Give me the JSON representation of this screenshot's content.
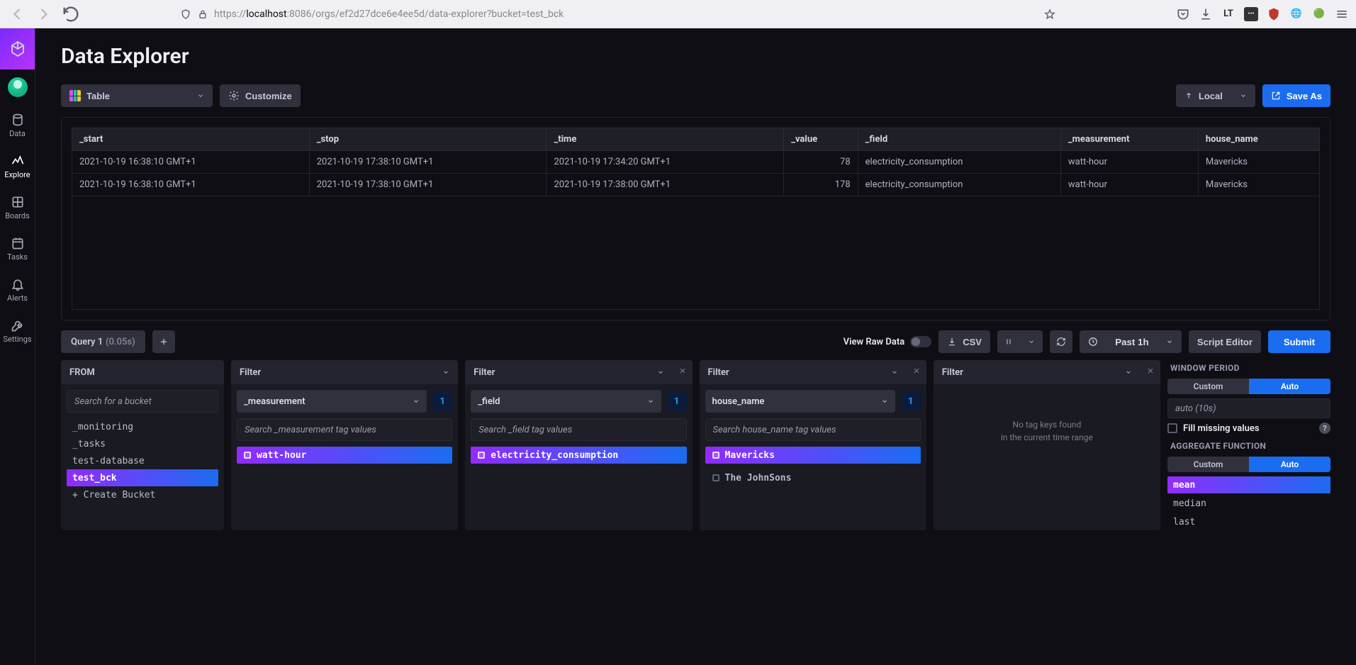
{
  "browser": {
    "url_prefix": "https://",
    "url_domain": "localhost",
    "url_rest": ":8086/orgs/ef2d27dce6e4ee5d/data-explorer?bucket=test_bck"
  },
  "sidebar": {
    "items": [
      {
        "label": "Data"
      },
      {
        "label": "Explore"
      },
      {
        "label": "Boards"
      },
      {
        "label": "Tasks"
      },
      {
        "label": "Alerts"
      },
      {
        "label": "Settings"
      }
    ]
  },
  "page": {
    "title": "Data Explorer"
  },
  "topbar": {
    "view_type": "Table",
    "customize": "Customize",
    "local": "Local",
    "save_as": "Save As"
  },
  "table": {
    "columns": [
      "_start",
      "_stop",
      "_time",
      "_value",
      "_field",
      "_measurement",
      "house_name"
    ],
    "rows": [
      {
        "_start": "2021-10-19 16:38:10 GMT+1",
        "_stop": "2021-10-19 17:38:10 GMT+1",
        "_time": "2021-10-19 17:34:20 GMT+1",
        "_value": "78",
        "_field": "electricity_consumption",
        "_measurement": "watt-hour",
        "house_name": "Mavericks"
      },
      {
        "_start": "2021-10-19 16:38:10 GMT+1",
        "_stop": "2021-10-19 17:38:10 GMT+1",
        "_time": "2021-10-19 17:38:00 GMT+1",
        "_value": "178",
        "_field": "electricity_consumption",
        "_measurement": "watt-hour",
        "house_name": "Mavericks"
      }
    ]
  },
  "query": {
    "tab_label": "Query 1",
    "tab_duration": "(0.05s)",
    "raw_label": "View Raw Data",
    "csv": "CSV",
    "range": "Past 1h",
    "script_editor": "Script Editor",
    "submit": "Submit"
  },
  "from": {
    "label": "FROM",
    "search_placeholder": "Search for a bucket",
    "buckets": [
      "_monitoring",
      "_tasks",
      "test-database",
      "test_bck",
      "+ Create Bucket"
    ],
    "selected": "test_bck"
  },
  "filters": [
    {
      "title": "Filter",
      "tag_key": "_measurement",
      "count": "1",
      "search_placeholder": "Search _measurement tag values",
      "values": [
        {
          "name": "watt-hour",
          "selected": true
        }
      ]
    },
    {
      "title": "Filter",
      "tag_key": "_field",
      "count": "1",
      "search_placeholder": "Search _field tag values",
      "values": [
        {
          "name": "electricity_consumption",
          "selected": true
        }
      ]
    },
    {
      "title": "Filter",
      "tag_key": "house_name",
      "count": "1",
      "search_placeholder": "Search house_name tag values",
      "values": [
        {
          "name": "Mavericks",
          "selected": true
        },
        {
          "name": "The JohnSons",
          "selected": false
        }
      ]
    },
    {
      "title": "Filter",
      "empty_line1": "No tag keys found",
      "empty_line2": "in the current time range"
    }
  ],
  "agg": {
    "window_title": "WINDOW PERIOD",
    "seg_custom": "Custom",
    "seg_auto": "Auto",
    "auto_value": "auto (10s)",
    "fill_label": "Fill missing values",
    "func_title": "AGGREGATE FUNCTION",
    "functions": [
      "mean",
      "median",
      "last"
    ],
    "selected_fn": "mean"
  }
}
